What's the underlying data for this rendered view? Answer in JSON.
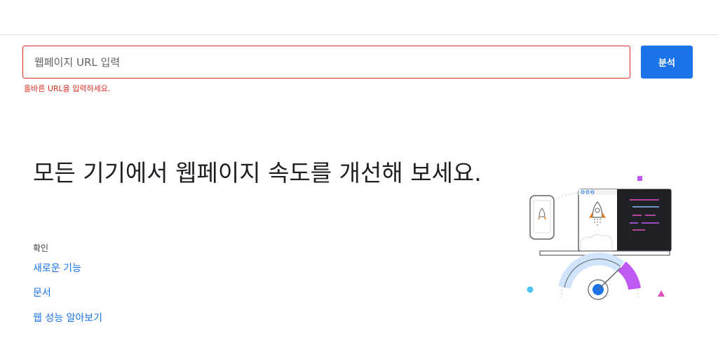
{
  "header": {},
  "search": {
    "placeholder": "웹페이지 URL 입력",
    "value": "",
    "error": "올바른 URL을 입력하세요.",
    "analyze_label": "분석"
  },
  "main": {
    "headline": "모든 기기에서 웹페이지 속도를 개선해 보세요.",
    "section_label": "확인",
    "links": [
      "새로운 기능",
      "문서",
      "웹 성능 알아보기"
    ]
  },
  "illustration": {
    "icon": "rocket-speedometer-illustration"
  },
  "colors": {
    "accent": "#1a73e8",
    "error": "#d93025",
    "text": "#202124",
    "illustration_purple": "#c058f3",
    "illustration_light_blue": "#d2e3fc",
    "illustration_pink": "#e052c2",
    "illustration_cyan": "#4fc3f7",
    "code_panel": "#202124"
  }
}
